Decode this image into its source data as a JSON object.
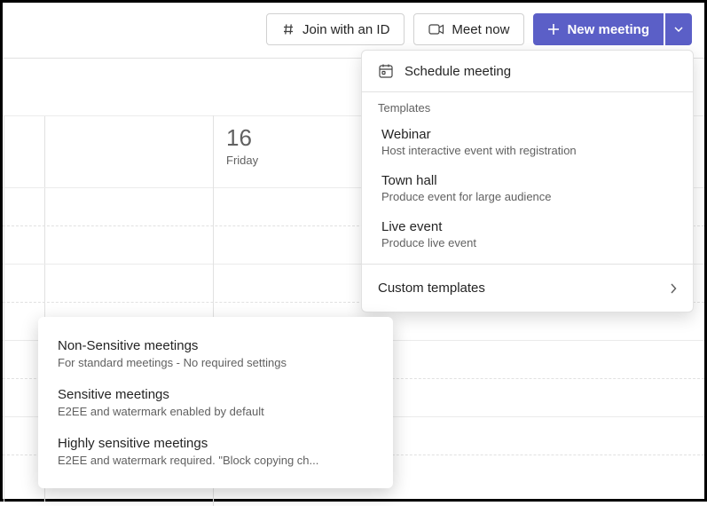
{
  "toolbar": {
    "join_id_label": "Join with an ID",
    "meet_now_label": "Meet now",
    "new_meeting_label": "New meeting"
  },
  "calendar": {
    "day_number": "16",
    "day_name": "Friday"
  },
  "dropdown": {
    "schedule_label": "Schedule meeting",
    "templates_header": "Templates",
    "templates": [
      {
        "title": "Webinar",
        "desc": "Host interactive event with registration"
      },
      {
        "title": "Town hall",
        "desc": "Produce event for large audience"
      },
      {
        "title": "Live event",
        "desc": "Produce live event"
      }
    ],
    "custom_label": "Custom templates"
  },
  "custom_templates": [
    {
      "title": "Non-Sensitive meetings",
      "desc": "For standard meetings - No required settings"
    },
    {
      "title": "Sensitive meetings",
      "desc": "E2EE and watermark enabled by default"
    },
    {
      "title": "Highly sensitive meetings",
      "desc": "E2EE and watermark required. \"Block copying ch..."
    }
  ]
}
